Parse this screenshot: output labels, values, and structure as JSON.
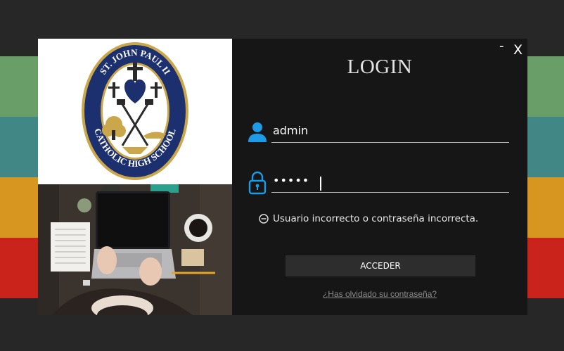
{
  "window": {
    "minimize_label": "-",
    "close_label": "X"
  },
  "logo": {
    "text_top": "ST. JOHN PAUL II",
    "text_bottom": "CATHOLIC HIGH SCHOOL"
  },
  "login": {
    "title": "LOGIN",
    "username": {
      "value": "admin",
      "icon": "user-icon"
    },
    "password": {
      "value": "•••••",
      "icon": "lock-icon"
    },
    "error": {
      "text": "Usuario incorrecto o contraseña incorrecta.",
      "icon": "minus-circle-icon"
    },
    "submit_label": "ACCEDER",
    "forgot_label": "¿Has olvidado su contraseña?"
  },
  "colors": {
    "background": "#272727",
    "stripes": [
      "#6a9e68",
      "#418786",
      "#d7961f",
      "#c9231c"
    ],
    "accent_blue": "#1e9be6",
    "navy": "#1c2f6e",
    "gold": "#c9a74a"
  }
}
